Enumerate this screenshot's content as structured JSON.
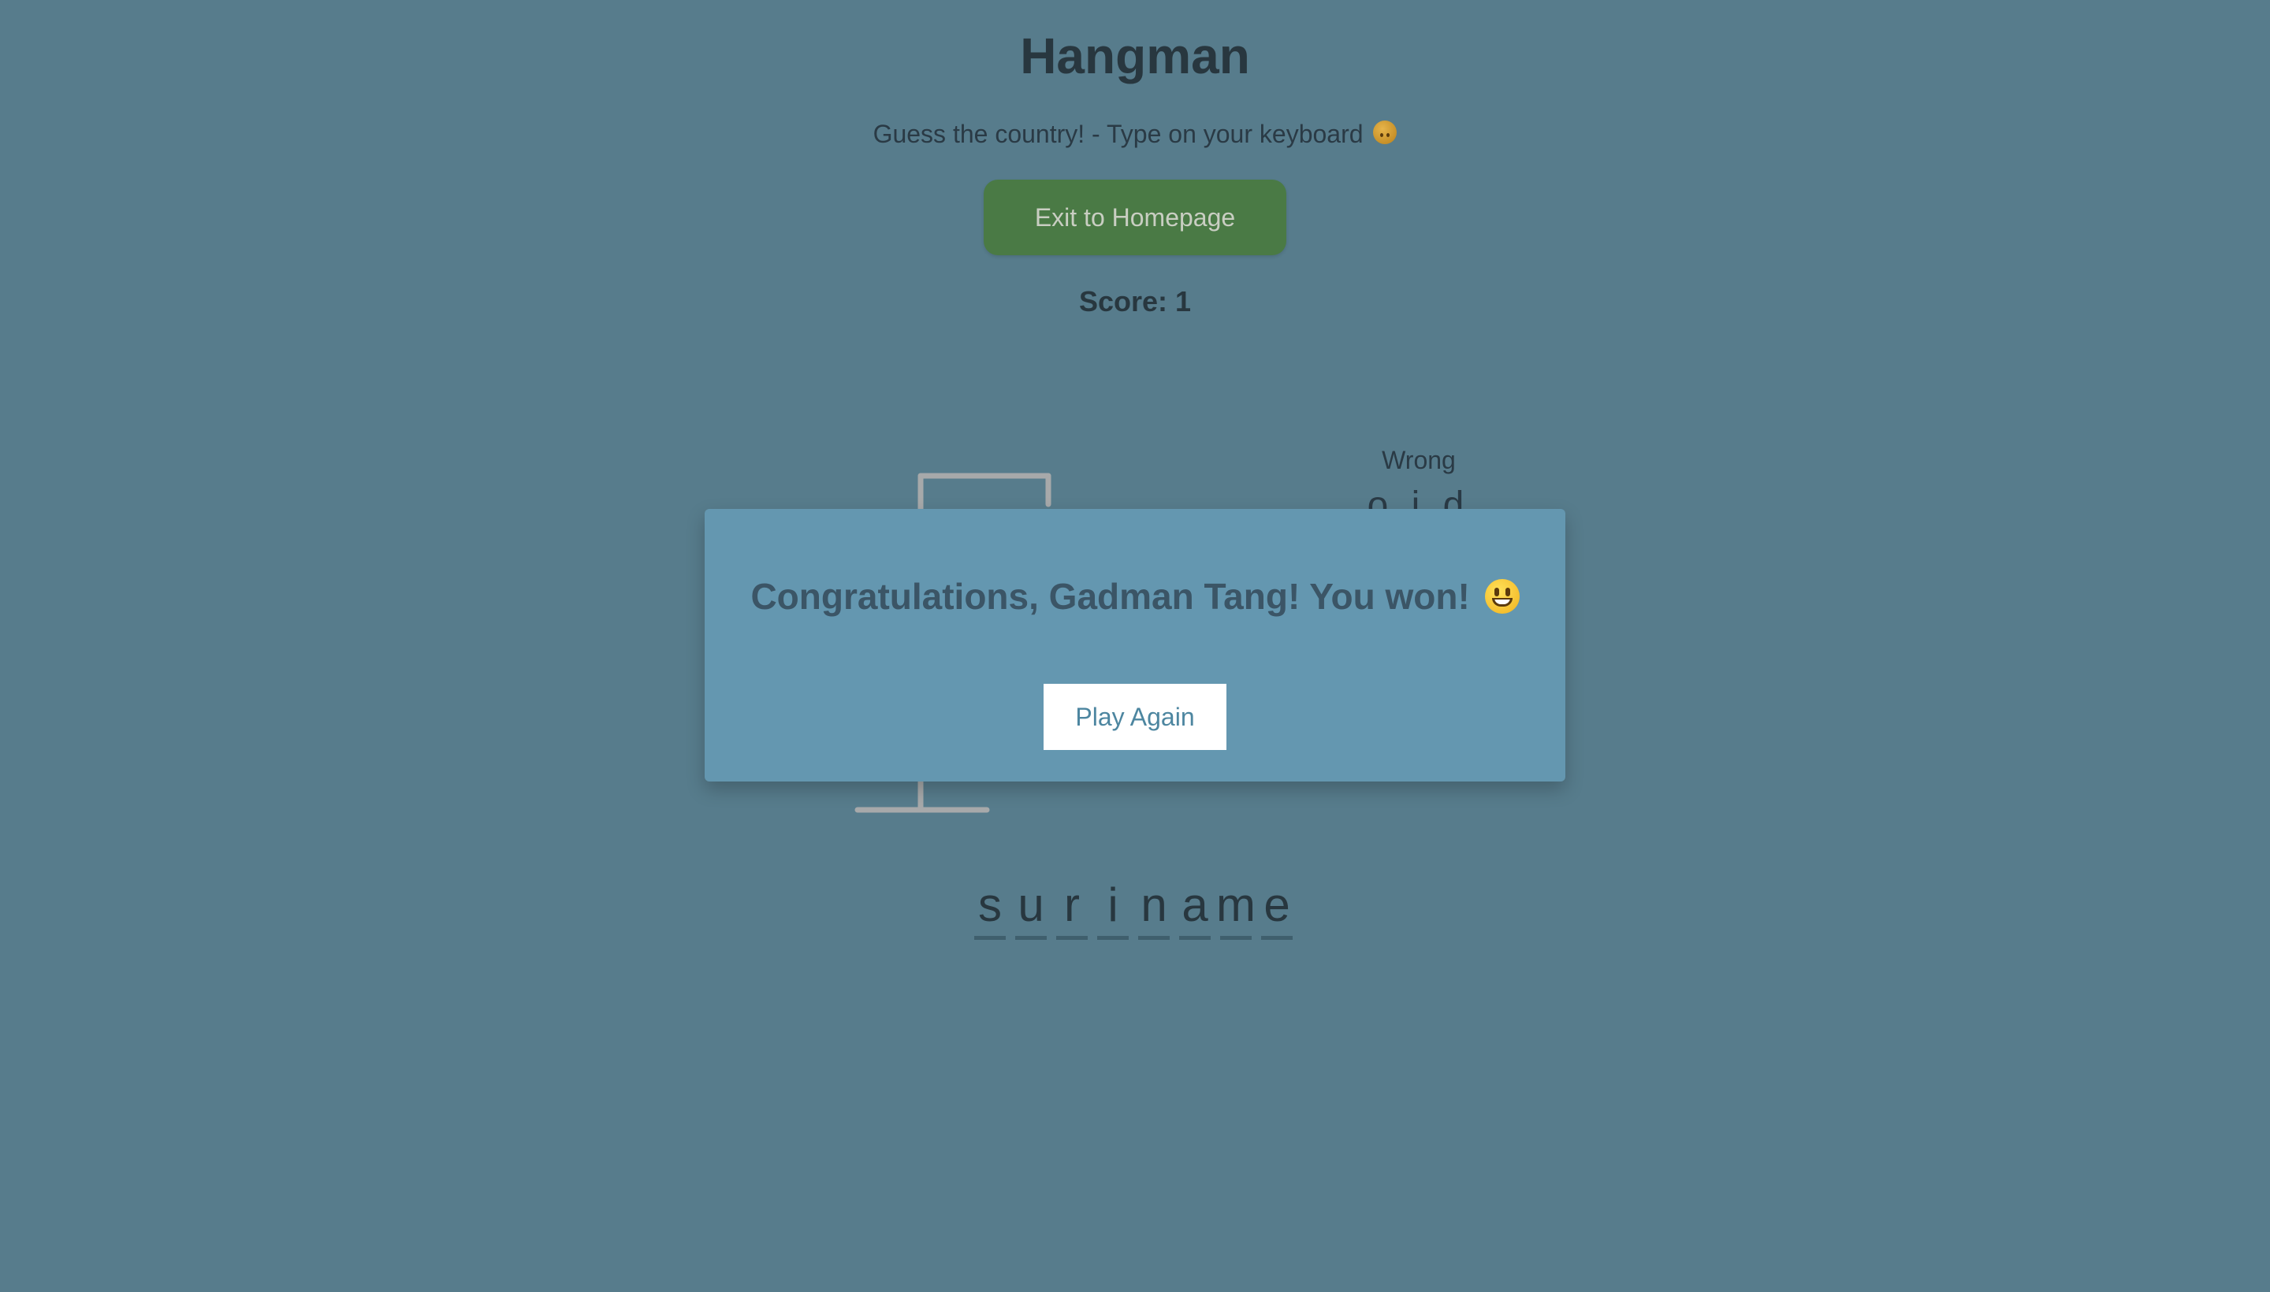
{
  "header": {
    "title": "Hangman",
    "subtitle": "Guess the country! - Type on your keyboard",
    "subtitle_emoji": "upside-down-face-icon",
    "exit_button_label": "Exit to Homepage",
    "score_text": "Score: 1"
  },
  "game": {
    "wrong_label": "Wrong",
    "wrong_letters": "o,i,d",
    "word_letters": [
      "s",
      "u",
      "r",
      "i",
      "n",
      "a",
      "m",
      "e"
    ]
  },
  "modal": {
    "message": "Congratulations, Gadman Tang! You won!",
    "message_emoji": "smiling-face-icon",
    "play_again_label": "Play Again"
  },
  "colors": {
    "background": "#577c8c",
    "exit_button": "#4a7a45",
    "modal_background": "#6497b0",
    "play_again_text": "#4d86a0"
  }
}
